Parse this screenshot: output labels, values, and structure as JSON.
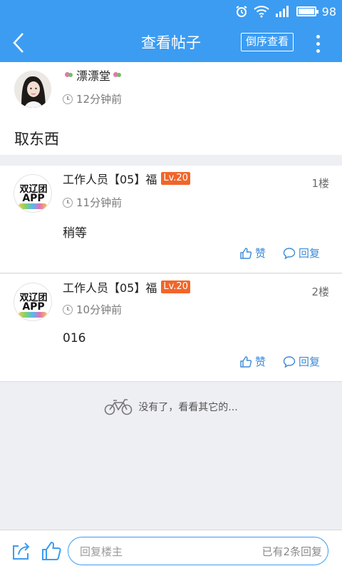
{
  "status_bar": {
    "battery_level": "98"
  },
  "header": {
    "title": "查看帖子",
    "reverse_label": "倒序查看"
  },
  "op": {
    "name": "漂漂堂",
    "time": "12分钟前",
    "content": "取东西"
  },
  "replies": [
    {
      "name": "工作人员【05】福",
      "level": "Lv.20",
      "time": "11分钟前",
      "floor": "1楼",
      "content": "稍等",
      "avatar_line1": "双辽团",
      "avatar_line2": "APP"
    },
    {
      "name": "工作人员【05】福",
      "level": "Lv.20",
      "time": "10分钟前",
      "floor": "2楼",
      "content": "016",
      "avatar_line1": "双辽团",
      "avatar_line2": "APP"
    }
  ],
  "actions": {
    "like_label": "赞",
    "reply_label": "回复"
  },
  "end_message": "没有了，看看其它的...",
  "bottom": {
    "placeholder": "回复楼主",
    "reply_count": "已有2条回复"
  },
  "colors": {
    "primary": "#3c9cf2",
    "level_badge": "#f0662a",
    "action_text": "#3c8ad8"
  }
}
